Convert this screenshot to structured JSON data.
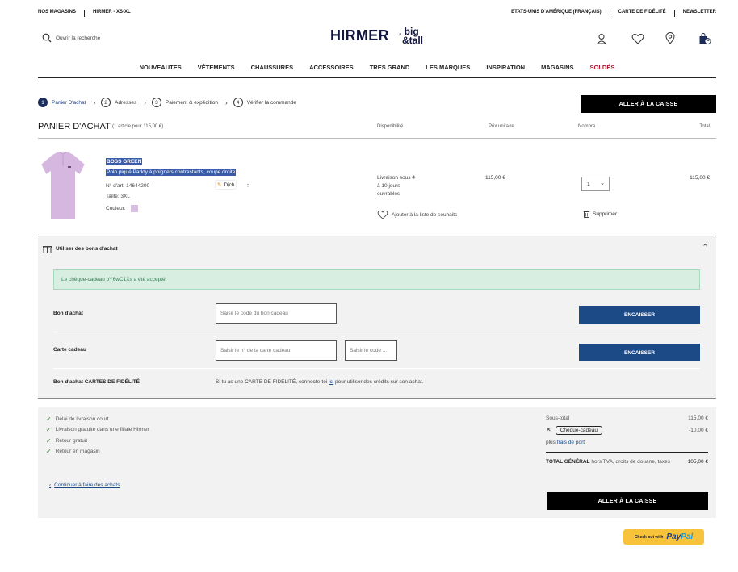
{
  "topbar": {
    "stores": "NOS MAGASINS",
    "sizes": "HIRMER - XS-XL",
    "country": "ETATS-UNIS D'AMÉRIQUE (FRANÇAIS)",
    "loyalty": "CARTE DE FIDÉLITÉ",
    "newsletter": "NEWSLETTER"
  },
  "search": {
    "placeholder": "Ouvrir la recherche"
  },
  "logo": {
    "main": "HIRMER",
    "sub1": ". big",
    "sub2": "&tall"
  },
  "header_icons": [
    "account-icon",
    "wishlist-heart-icon",
    "store-location-icon",
    "cart-bag-icon"
  ],
  "cart_badge": "1",
  "nav": [
    "NOUVEAUTES",
    "VÊTEMENTS",
    "CHAUSSURES",
    "ACCESSOIRES",
    "TRES GRAND",
    "LES MARQUES",
    "INSPIRATION",
    "MAGASINS",
    "SOLDÉS"
  ],
  "steps": [
    {
      "num": "1",
      "label": "Panier D'achat"
    },
    {
      "num": "2",
      "label": "Adresses"
    },
    {
      "num": "3",
      "label": "Paiement & expédition"
    },
    {
      "num": "4",
      "label": "Vérifier la commande"
    }
  ],
  "checkout_button": "ALLER À LA CAISSE",
  "cart": {
    "title": "PANIER D'ACHAT",
    "count": "(1 article pour 115,00 €)",
    "col_availability": "Disponibilité",
    "col_unit_price": "Prix unitaire",
    "col_qty": "Nombre",
    "col_total": "Total"
  },
  "item": {
    "brand": "BOSS GREEN",
    "name": "Polo piqué Paddy à poignets contrastants, coupe droite",
    "article": "N° d'art. 14644200",
    "size": "Taille:   3XL",
    "color_label": "Couleur:",
    "popup": "Dịch",
    "availability_line1": "Livraison sous 4",
    "availability_line2": "à 10 jours",
    "availability_line3": "ouvrables",
    "wishlist": "Ajouter à la liste de souhaits",
    "unit_price": "115,00 €",
    "qty": "1",
    "delete": "Supprimer",
    "total": "115,00 €",
    "swatch_color": "#d6bfe0"
  },
  "vouchers": {
    "heading": "Utiliser des bons d'achat",
    "alert": "Le chèque-cadeau bY6wC1Xs a été accepté.",
    "voucher_label": "Bon d'achat",
    "voucher_placeholder": "Saisir le code du bon cadeau",
    "giftcard_label": "Carte cadeau",
    "giftcard_placeholder": "Saisir le n° de la carte cadeau",
    "giftcard_code_placeholder": "Saisir le code ...",
    "redeem": "ENCAISSER",
    "loyalty_label": "Bon d'achat CARTES DE FIDÉLITÉ",
    "loyalty_text_1": "Si tu as une ",
    "loyalty_text_bold": "CARTE DE FIDÉLITÉ",
    "loyalty_text_2": ", connecte-toi ",
    "loyalty_link": "ici",
    "loyalty_text_3": " pour utiliser des crédits sur son achat."
  },
  "perks": [
    "Délai de livraison court",
    "Livraison gratuite dans une filiale Hirmer",
    "Retour gratuit",
    "Retour en magasin"
  ],
  "continue": "Continuer à faire des achats",
  "summary": {
    "subtotal_label": "Sous-total",
    "subtotal": "115,00 €",
    "cheque_label": "Chèque-cadeau",
    "cheque_value": "-10,00 €",
    "shipping_prefix": "plus ",
    "shipping_link": "frais de port",
    "total_label": "TOTAL GÉNÉRAL",
    "total_note": "hors TVA, droits de douane, taxes",
    "total": "105,00 €"
  },
  "paypal": {
    "checkout_with": "Check out with",
    "pay": "Pay",
    "pal": "Pal"
  }
}
